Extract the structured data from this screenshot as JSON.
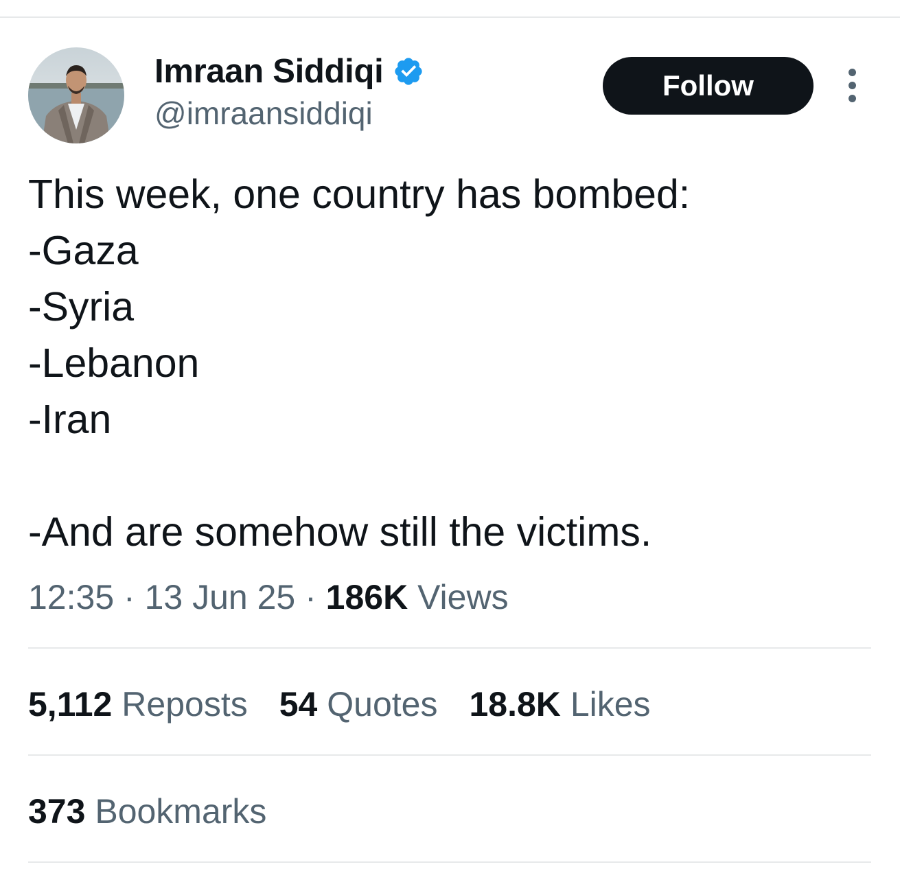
{
  "author": {
    "display_name": "Imraan Siddiqi",
    "handle": "@imraansiddiqi",
    "verified": true,
    "verified_color": "#1d9bf0"
  },
  "follow_label": "Follow",
  "tweet": {
    "lines": [
      "This week, one country has bombed:",
      "-Gaza",
      "-Syria",
      "-Lebanon",
      "-Iran",
      "",
      "-And are somehow still the victims."
    ]
  },
  "meta": {
    "time": "12:35",
    "date": "13 Jun 25",
    "views_count": "186K",
    "views_label": "Views"
  },
  "stats": {
    "reposts_count": "5,112",
    "reposts_label": "Reposts",
    "quotes_count": "54",
    "quotes_label": "Quotes",
    "likes_count": "18.8K",
    "likes_label": "Likes"
  },
  "bookmarks": {
    "count": "373",
    "label": "Bookmarks"
  },
  "icons": {
    "verified": "verified-badge-icon",
    "more": "more-options-icon"
  }
}
